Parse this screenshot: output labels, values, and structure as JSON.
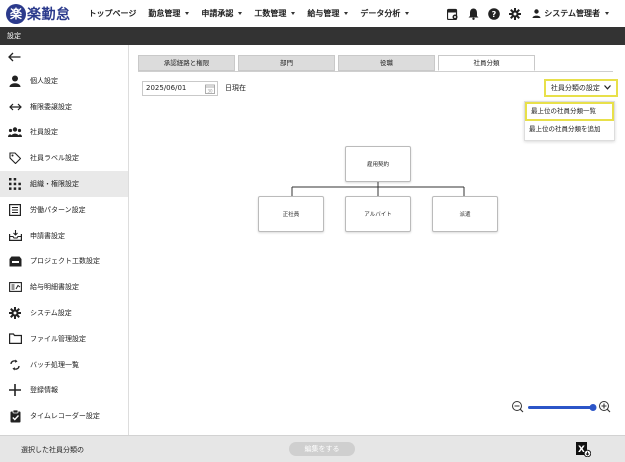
{
  "app": {
    "logo_mark": "楽",
    "logo_text": "楽勤怠"
  },
  "nav": {
    "items": [
      {
        "label": "トップページ",
        "has_caret": false
      },
      {
        "label": "勤怠管理",
        "has_caret": true
      },
      {
        "label": "申請承認",
        "has_caret": true
      },
      {
        "label": "工数管理",
        "has_caret": true
      },
      {
        "label": "給与管理",
        "has_caret": true
      },
      {
        "label": "データ分析",
        "has_caret": true
      }
    ],
    "icons": [
      "calendar-settings-icon",
      "bell-icon",
      "help-icon",
      "gear-icon"
    ],
    "user": "システム管理者"
  },
  "title_bar": "設定",
  "sidebar": {
    "back_icon": "arrow-left-icon",
    "items": [
      {
        "label": "個人設定",
        "icon": "person-icon",
        "active": false
      },
      {
        "label": "権限委譲設定",
        "icon": "swap-arrows-icon",
        "active": false
      },
      {
        "label": "社員設定",
        "icon": "people-icon",
        "active": false
      },
      {
        "label": "社員ラベル設定",
        "icon": "tag-icon",
        "active": false
      },
      {
        "label": "組織・権限設定",
        "icon": "dots-grid-icon",
        "active": true
      },
      {
        "label": "労働パターン設定",
        "icon": "list-icon",
        "active": false
      },
      {
        "label": "申請書設定",
        "icon": "inbox-icon",
        "active": false
      },
      {
        "label": "プロジェクト工数設定",
        "icon": "folder-inbox-icon",
        "active": false
      },
      {
        "label": "給与明細書設定",
        "icon": "pay-slip-icon",
        "active": false
      },
      {
        "label": "システム設定",
        "icon": "gear-icon",
        "active": false
      },
      {
        "label": "ファイル管理設定",
        "icon": "folder-icon",
        "active": false
      },
      {
        "label": "バッチ処理一覧",
        "icon": "cycle-icon",
        "active": false
      },
      {
        "label": "登録情報",
        "icon": "plus-icon",
        "active": false
      },
      {
        "label": "タイムレコーダー設定",
        "icon": "clipboard-check-icon",
        "active": false
      }
    ]
  },
  "tabs": [
    {
      "label": "承認経路と権限",
      "active": false
    },
    {
      "label": "部門",
      "active": false
    },
    {
      "label": "役職",
      "active": false
    },
    {
      "label": "社員分類",
      "active": true
    }
  ],
  "date": {
    "value": "2025/06/01",
    "suffix": "日現在"
  },
  "settings_dropdown": {
    "label": "社員分類の設定",
    "items": [
      "最上位の社員分類一覧",
      "最上位の社員分類を追加"
    ]
  },
  "org_chart": {
    "root": "雇用契約",
    "children": [
      "正社員",
      "アルバイト",
      "派遣"
    ]
  },
  "zoom": {
    "level": 1.0
  },
  "bottom_bar": {
    "selected_label": "選択した社員分類の",
    "edit_button": "編集をする"
  },
  "colors": {
    "brand": "#2b3a8c",
    "highlight": "#e8e04a",
    "zoom_slider": "#2b55c8"
  }
}
